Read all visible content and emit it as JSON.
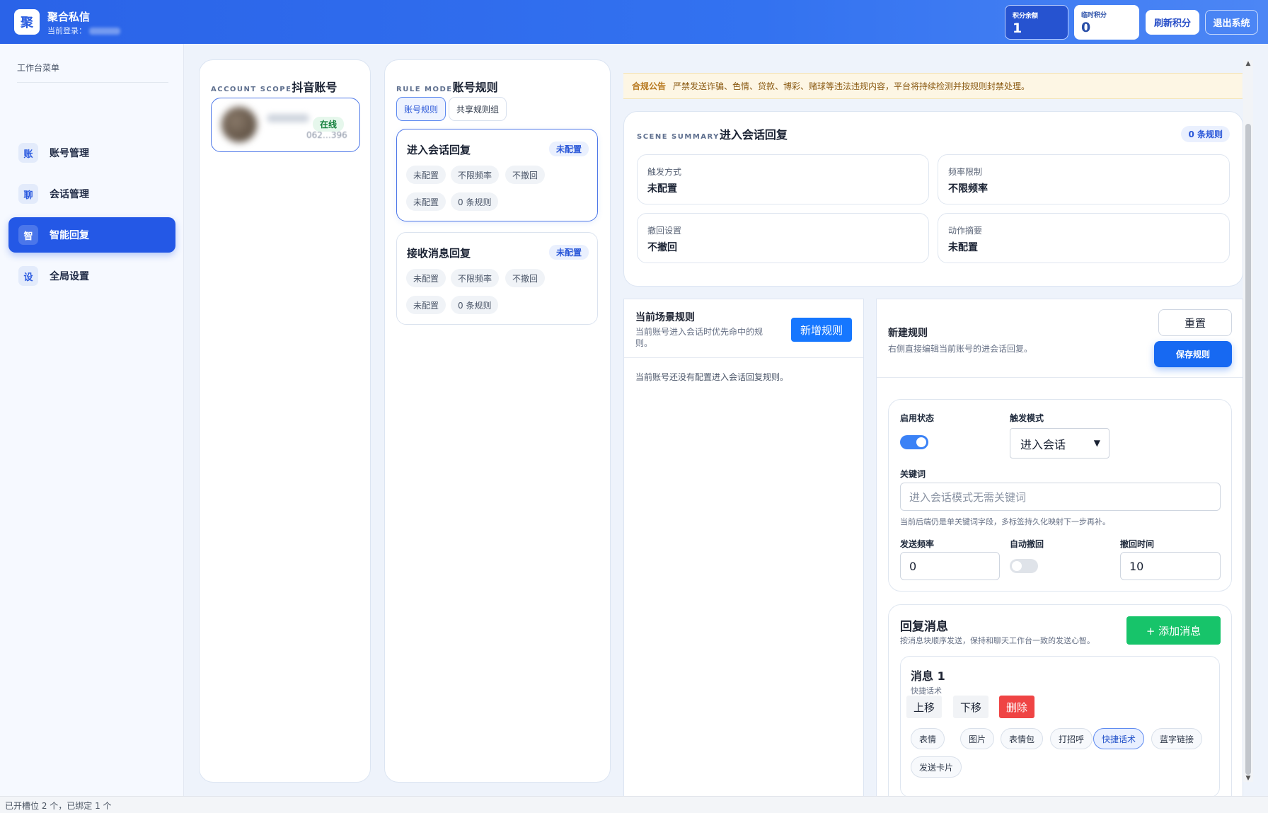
{
  "header": {
    "logo_char": "聚",
    "app_title": "聚合私信",
    "login_prefix": "当前登录：",
    "points_balance_label": "积分余额",
    "points_balance_value": "1",
    "temp_points_label": "临时积分",
    "temp_points_value": "0",
    "refresh_label": "刷新积分",
    "logout_label": "退出系统"
  },
  "sidebar": {
    "title": "工作台菜单",
    "items": [
      {
        "icon": "账",
        "label": "账号管理"
      },
      {
        "icon": "聊",
        "label": "会话管理"
      },
      {
        "icon": "智",
        "label": "智能回复"
      },
      {
        "icon": "设",
        "label": "全局设置"
      }
    ]
  },
  "accounts_panel": {
    "eyebrow": "ACCOUNT SCOPE",
    "title": "抖音账号",
    "card": {
      "status": "在线",
      "id_text": "062…396"
    }
  },
  "rules_panel": {
    "eyebrow": "RULE MODE",
    "title": "账号规则",
    "tabs": [
      "账号规则",
      "共享规则组"
    ],
    "scenes": [
      {
        "title": "进入会话回复",
        "badge": "未配置",
        "chips": [
          "未配置",
          "不限频率",
          "不撤回",
          "未配置",
          "0 条规则"
        ]
      },
      {
        "title": "接收消息回复",
        "badge": "未配置",
        "chips": [
          "未配置",
          "不限频率",
          "不撤回",
          "未配置",
          "0 条规则"
        ]
      }
    ]
  },
  "notice": {
    "tag": "合规公告",
    "text": "严禁发送诈骗、色情、贷款、博彩、赌球等违法违规内容，平台将持续检测并按规则封禁处理。"
  },
  "summary": {
    "eyebrow": "SCENE SUMMARY",
    "title": "进入会话回复",
    "badge": "0 条规则",
    "cells": [
      {
        "label": "触发方式",
        "value": "未配置"
      },
      {
        "label": "频率限制",
        "value": "不限频率"
      },
      {
        "label": "撤回设置",
        "value": "不撤回"
      },
      {
        "label": "动作摘要",
        "value": "未配置"
      }
    ]
  },
  "current_rules": {
    "title": "当前场景规则",
    "subtitle": "当前账号进入会话时优先命中的规则。",
    "add_label": "新增规则",
    "empty_text": "当前账号还没有配置进入会话回复规则。"
  },
  "rule_form": {
    "title": "新建规则",
    "subtitle": "右侧直接编辑当前账号的进会话回复。",
    "reset_label": "重置",
    "save_label": "保存规则",
    "enabled_label": "启用状态",
    "enabled": true,
    "trigger_label": "触发模式",
    "trigger_value": "进入会话",
    "keyword_label": "关键词",
    "keyword_placeholder": "进入会话模式无需关键词",
    "keyword_hint": "当前后端仍是单关键词字段，多标签持久化映射下一步再补。",
    "freq_label": "发送频率",
    "freq_value": "0",
    "auto_recall_label": "自动撤回",
    "auto_recall": false,
    "recall_time_label": "撤回时间",
    "recall_time_value": "10"
  },
  "reply_messages": {
    "title": "回复消息",
    "subtitle": "按消息块顺序发送，保持和聊天工作台一致的发送心智。",
    "add_label": "+ 添加消息",
    "message": {
      "title": "消息 1",
      "type": "快捷话术",
      "up_label": "上移",
      "down_label": "下移",
      "delete_label": "删除",
      "types": [
        "表情",
        "图片",
        "表情包",
        "打招呼",
        "快捷话术",
        "蓝字链接",
        "发送卡片"
      ],
      "active_type": "快捷话术"
    }
  },
  "footer": {
    "status": "已开槽位 2 个，已绑定 1 个"
  },
  "colors": {
    "accent": "#2458e6",
    "online": "#15803d",
    "danger": "#ef4444",
    "success": "#17c46a"
  }
}
